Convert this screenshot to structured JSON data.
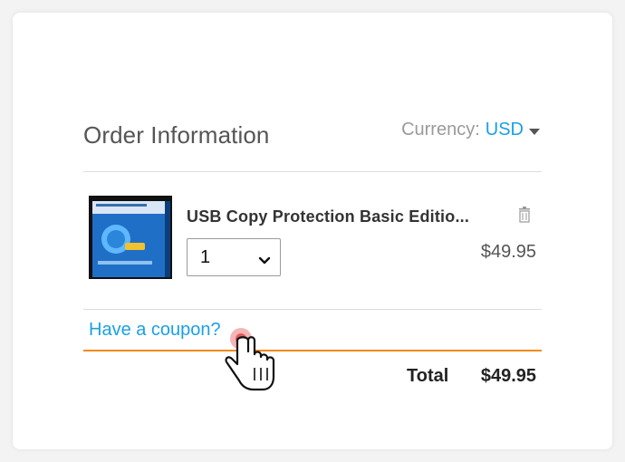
{
  "order": {
    "title": "Order Information",
    "currency_label": "Currency:",
    "currency_value": "USD"
  },
  "item": {
    "name": "USB Copy Protection Basic Editio...",
    "quantity": "1",
    "price": "$49.95"
  },
  "coupon": {
    "link_text": "Have a coupon?"
  },
  "summary": {
    "total_label": "Total",
    "total_value": "$49.95"
  },
  "colors": {
    "accent": "#1aa0e6",
    "divider_active": "#f08a1c"
  },
  "icons": [
    "caret-down-icon",
    "trash-icon",
    "chevron-down-icon",
    "hand-cursor-icon"
  ]
}
